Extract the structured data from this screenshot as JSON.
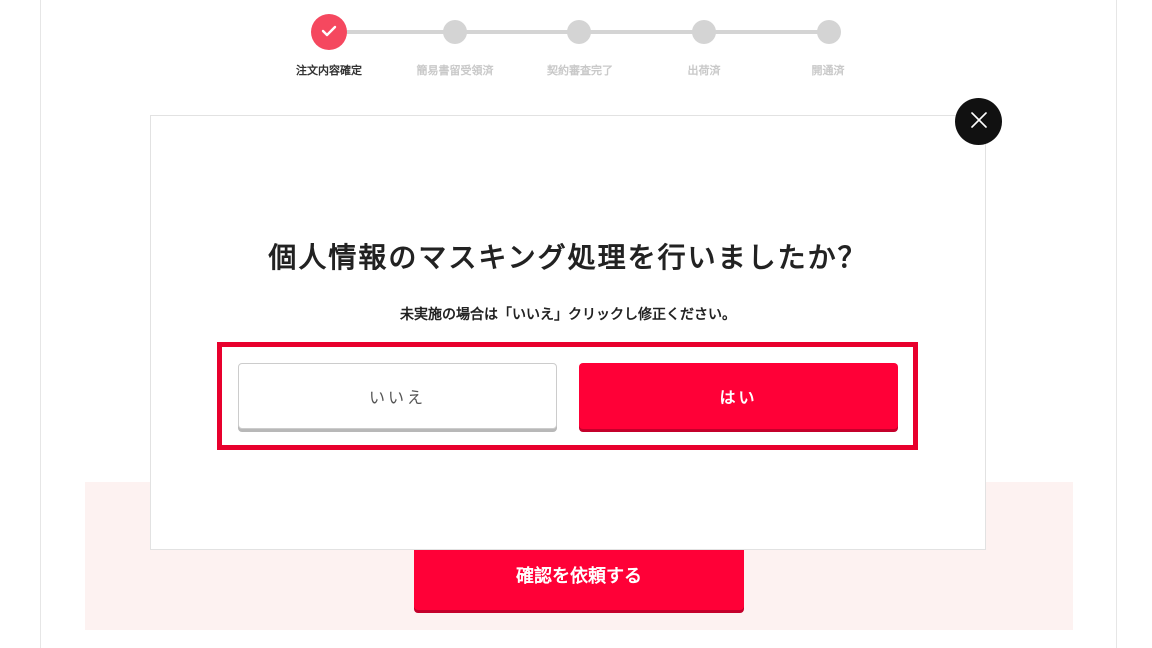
{
  "stepper": {
    "steps": [
      {
        "label": "注文内容確定",
        "state": "done"
      },
      {
        "label": "簡易書留受領済",
        "state": "pending"
      },
      {
        "label": "契約審査完了",
        "state": "pending"
      },
      {
        "label": "出荷済",
        "state": "pending"
      },
      {
        "label": "開通済",
        "state": "pending"
      }
    ],
    "done_icon": "check-icon",
    "active_color": "#f5485f",
    "inactive_color": "#d4d4d4"
  },
  "modal": {
    "title": "個人情報のマスキング処理を行いましたか？",
    "subtitle": "未実施の場合は「いいえ」クリックし修正ください。",
    "no_label": "いいえ",
    "yes_label": "はい",
    "close_icon": "close-icon",
    "highlight_color": "#e8002d"
  },
  "main": {
    "request_button_label": "確認を依頼する",
    "brand_color": "#ff0037",
    "section_background": "#fdf2f1"
  }
}
